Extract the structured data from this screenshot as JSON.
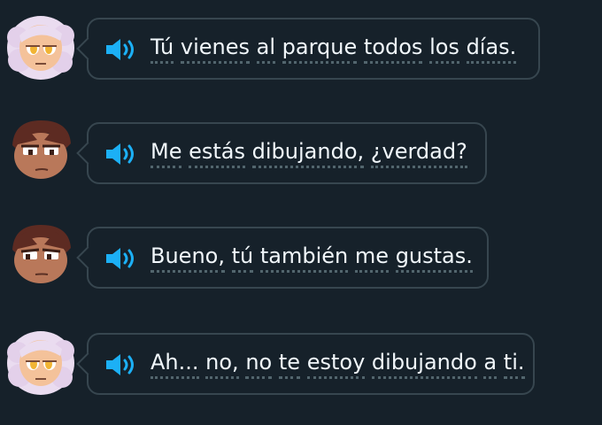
{
  "colors": {
    "background": "#16212a",
    "bubble_border": "#37464f",
    "text": "#f1f7fb",
    "speaker_blue": "#1cb0f6",
    "dotted_underline": "#52656d"
  },
  "messages": [
    {
      "speaker": "girl",
      "words": [
        "Tú",
        "viene"
      ],
      "line": "Tú vienes al parque todos los días."
    },
    {
      "speaker": "boy",
      "line": "Me estás dibujando, ¿verdad?"
    },
    {
      "speaker": "boy",
      "line": "Bueno, tú también me gustas."
    },
    {
      "speaker": "girl",
      "line": "Ah... no, no te estoy dibujando a ti."
    }
  ],
  "icons": {
    "speaker": "speaker-icon",
    "avatar_girl": "girl-avatar",
    "avatar_boy": "boy-avatar"
  }
}
